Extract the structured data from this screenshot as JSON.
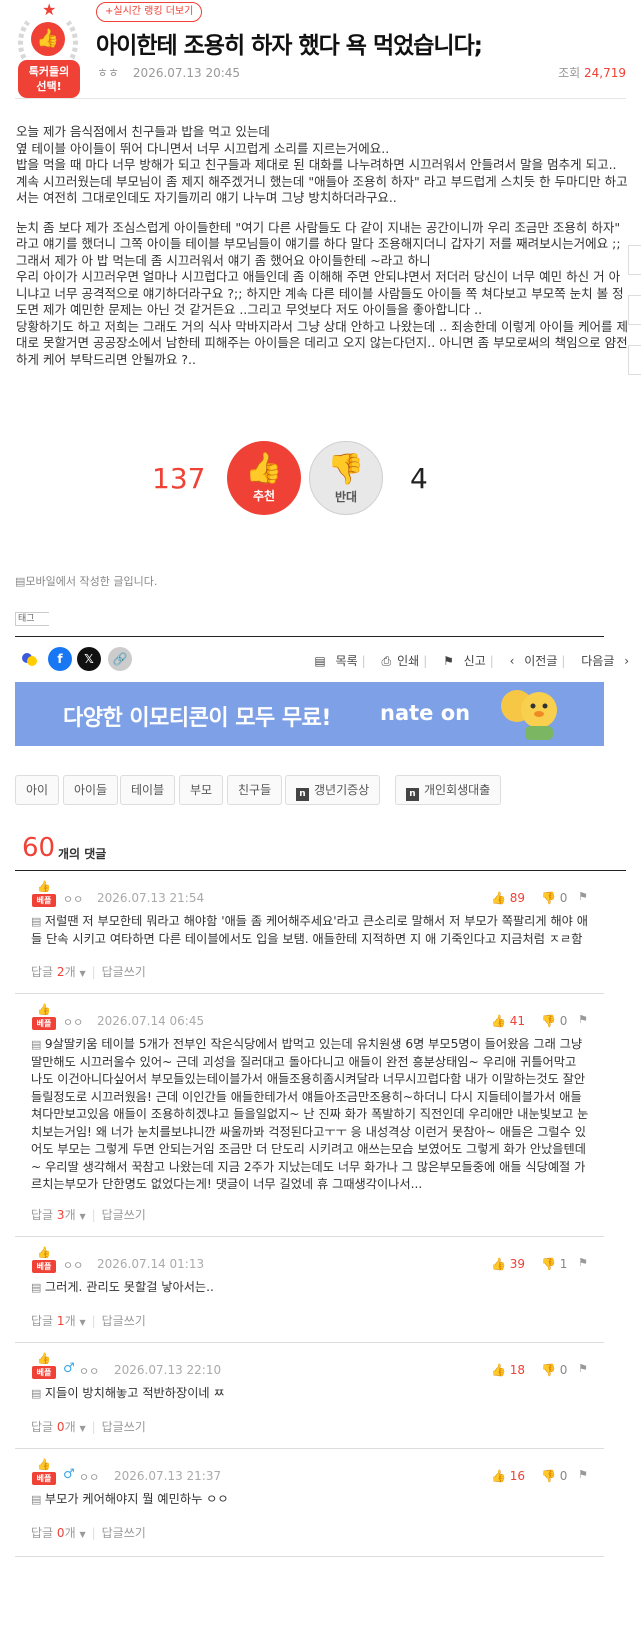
{
  "header": {
    "badge_label_1": "톡커들의",
    "badge_label_2": "선택!",
    "rank_button": "+실시간 랭킹 더보기",
    "title": "아이한테 조용히 하자 했다 욕 먹었습니다;",
    "author": "ㅎㅎ",
    "date": "2026.07.13 20:45",
    "views_label": "조회",
    "views": "24,719"
  },
  "post": {
    "paragraphs": [
      "오늘 제가 음식점에서 친구들과 밥을 먹고 있는데\n옆 테이블 아이들이 뛰어 다니면서 너무 시끄럽게 소리를 지르는거에요..\n밥을 먹을 때 마다 너무 방해가 되고 친구들과 제대로 된 대화를 나누려하면 시끄러워서 안들려서 말을 멈추게 되고.. 계속 시끄러웠는데 부모님이 좀 제지 해주겠거니 했는데 \"애들아 조용히 하자\" 라고 부드럽게 스치듯 한 두마디만 하고서는 여전히 그대로인데도 자기들끼리 얘기 나누며 그냥 방치하더라구요..",
      "눈치 좀 보다 제가 조심스럽게 아이들한테 \"여기 다른 사람들도 다 같이 지내는 공간이니까 우리 조금만 조용히 하자\" 라고 얘기를 했더니 그쪽 아이들 테이블 부모님들이 얘기를 하다 말다 조용해지더니 갑자기 저를 째려보시는거에요 ;;\n그래서 제가 아 밥 먹는데 좀 시끄러워서 얘기 좀 했어요 아이들한테 ~라고 하니\n우리 아이가 시끄러우면 얼마나 시끄럽다고 애들인데 좀 이해해 주면 안되냐면서 저더러 당신이 너무 예민 하신 거 아니냐고 너무 공격적으로 얘기하더라구요 ?;; 하지만 계속 다른 테이블 사람들도 아이들 쪽 쳐다보고 부모쪽 눈치 볼 정도면 제가 예민한 문제는 아닌 것 같거든요 ..그리고 무엇보다 저도 아이들을 좋아합니다 ..\n당황하기도 하고 저희는 그래도 거의 식사 막바지라서 그냥 상대 안하고 나왔는데 .. 죄송한데 이렇게 아이들 케어를 제대로 못할거면 공공장소에서 남한테 피해주는 아이들은 데리고 오지 않는다던지.. 아니면 좀 부모로써의 책임으로 얌전하게 케어 부탁드리면 안될까요 ?.."
    ]
  },
  "vote": {
    "up_count": "137",
    "up_label": "추천",
    "down_count": "4",
    "down_label": "반대"
  },
  "mobile_note": "모바일에서 작성한 글입니다.",
  "tag_label": "태그",
  "post_tools": {
    "list": "목록",
    "print": "인쇄",
    "report": "신고",
    "prev": "이전글",
    "next": "다음글"
  },
  "ad": {
    "text": "다양한 이모티콘이 모두 무료!",
    "brand": "nate on"
  },
  "tags": [
    "아이",
    "아이들",
    "테이블",
    "부모",
    "친구들",
    "갱년기증상",
    "개인회생대출"
  ],
  "comments_header": {
    "count": "60",
    "label": "개의 댓글"
  },
  "comment_common": {
    "best_label": "베플",
    "reply_label": "답글",
    "reply_unit": "개",
    "write_reply": "답글쓰기"
  },
  "comments": [
    {
      "author": "ㅇㅇ",
      "date": "2026.07.13 21:54",
      "up": "89",
      "down": "0",
      "text": "저럴땐 저 부모한테 뭐라고 해야함 '애들 좀 케어해주세요'라고 큰소리로 말해서 저 부모가 쪽팔리게 해야 애들 단속 시키고 여타하면 다른 테이블에서도 입을 보탬. 애들한테 지적하면 지 애 기죽인다고 지금처럼 ㅈㄹ함",
      "replies": "2"
    },
    {
      "author": "ㅇㅇ",
      "date": "2026.07.14 06:45",
      "up": "41",
      "down": "0",
      "text": "9살딸키움 테이블 5개가 전부인 작은식당에서 밥먹고 있는데 유치원생 6명 부모5명이 들어왔음 그래 그냥 딸만해도 시끄러울수 있어~ 근데 괴성을 질러대고 돌아다니고 애들이 완전 흥분상태임~ 우리애 귀틀어막고 나도 이건아니다싶어서 부모들있는테이블가서 애들조용히좀시켜달라 너무시끄럽다함 내가 이말하는것도 잘안들릴정도로 시끄러웠음! 근데 이인간들 애들한테가서 얘들아조금만조용히~하더니 다시 지들테이블가서 애들 쳐다만보고있음 애들이 조용하히겠냐고 들을일없지~ 난 진짜 화가 폭발하기 직전인데 우리애만 내눈빛보고 눈치보는거임! 왜 너가 눈치를보냐니깐 싸울까봐 걱정된다고ㅜㅜ 응 내성격상 이런거 못참아~ 애들은 그럴수 있어도 부모는 그렇게 두면 안되는거임 조금만 더 단도리 시키려고 애쓰는모습 보였어도 그렇게 화가 안났을텐데~ 우리딸 생각해서 꾹참고 나왔는데 지금 2주가 지났는데도 너무 화가나 그 많은부모들중에 애들 식당예절 가르치는부모가 단한명도 없었다는게! 댓글이 너무 길었네 휴 그때생각이나서...",
      "replies": "3"
    },
    {
      "author": "ㅇㅇ",
      "date": "2026.07.14 01:13",
      "up": "39",
      "down": "1",
      "text": "그러게. 관리도 못할걸 낳아서는..",
      "replies": "1"
    },
    {
      "author": "ㅇㅇ",
      "date": "2026.07.13 22:10",
      "up": "18",
      "down": "0",
      "text": "지들이 방치해놓고 적반하장이네 ㅉ",
      "replies": "0",
      "gender": "♂"
    },
    {
      "author": "ㅇㅇ",
      "date": "2026.07.13 21:37",
      "up": "16",
      "down": "0",
      "text": "부모가 케어해야지 뭘 예민하누 ㅇㅇ",
      "replies": "0",
      "gender": "♂"
    }
  ],
  "colors": {
    "accent": "#ef4136",
    "ad_bg": "#7da0e6",
    "facebook": "#1877f2"
  }
}
